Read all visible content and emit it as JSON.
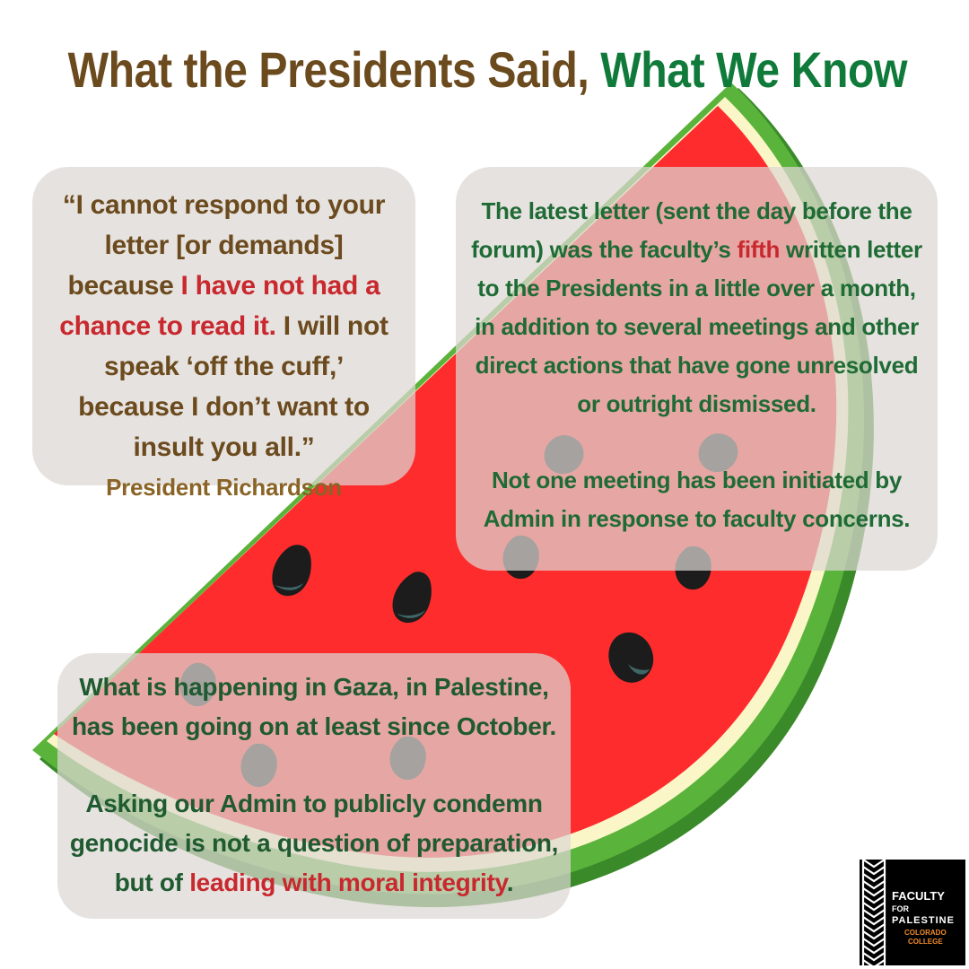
{
  "header": {
    "title_part1": "What the Presidents Said,",
    "title_part2": "What We Know"
  },
  "quote_box": {
    "text_1": "“I cannot respond to your letter [or demands] because",
    "text_highlight": "I have not had a chance to read it.",
    "text_2": "I will not speak ‘off the cuff,’ because I don’t want to insult you all.”",
    "attribution": "President Richardson"
  },
  "know_box": {
    "para1_part1": "The latest letter (sent the day before the forum) was the faculty’s",
    "para1_highlight": "fifth",
    "para1_part2": "written letter to the Presidents in a little over a month, in addition to several meetings and other direct actions that have gone unresolved or outright dismissed.",
    "para2": "Not one meeting has been initiated by Admin in response to faculty concerns."
  },
  "gaza_box": {
    "para1": "What is happening in Gaza, in Palestine, has been going on at least since October.",
    "para2_part1": "Asking our Admin to publicly condemn genocide is not a question of preparation, but of",
    "para2_highlight": "leading with moral integrity",
    "para2_part2": "."
  },
  "logo": {
    "line1": "FACULTY",
    "line2": "FOR",
    "line3": "PALESTINE",
    "line4": "COLORADO",
    "line5": "COLLEGE"
  },
  "colors": {
    "title_brown": "#6b4a1e",
    "title_green": "#0f7a3a",
    "flesh_red": "#fe2c2c",
    "rind_green": "#5ab33a",
    "rind_dark": "#3a8a2a",
    "rind_cream": "#fbf6c8",
    "highlight_red": "#c8282e",
    "logo_orange": "#f08a2a"
  }
}
